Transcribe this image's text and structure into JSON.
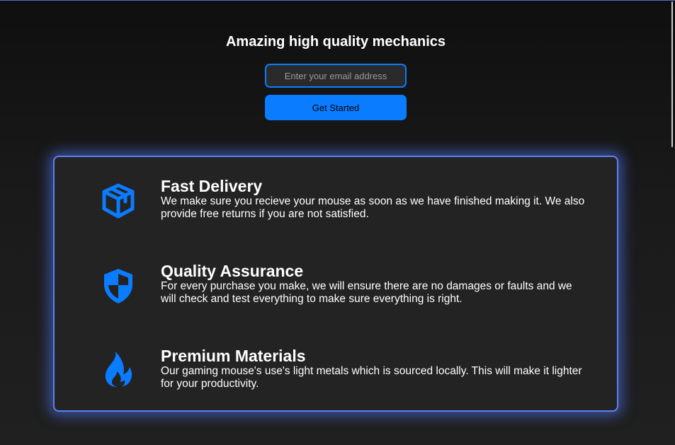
{
  "hero": {
    "title": "Amazing high quality mechanics",
    "email_placeholder": "Enter your email address",
    "cta_label": "Get Started"
  },
  "features": [
    {
      "icon": "box-icon",
      "title": "Fast Delivery",
      "description": "We make sure you recieve your mouse as soon as we have finished making it. We also provide free returns if you are not satisfied."
    },
    {
      "icon": "shield-icon",
      "title": "Quality Assurance",
      "description": "For every purchase you make, we will ensure there are no damages or faults and we will check and test everything to make sure everything is right."
    },
    {
      "icon": "fire-icon",
      "title": "Premium Materials",
      "description": "Our gaming mouse's use's light metals which is sourced locally. This will make it lighter for your productivity."
    }
  ],
  "colors": {
    "accent": "#0a7cff",
    "card_glow": "#5b82f0",
    "card_background": "#232323"
  }
}
